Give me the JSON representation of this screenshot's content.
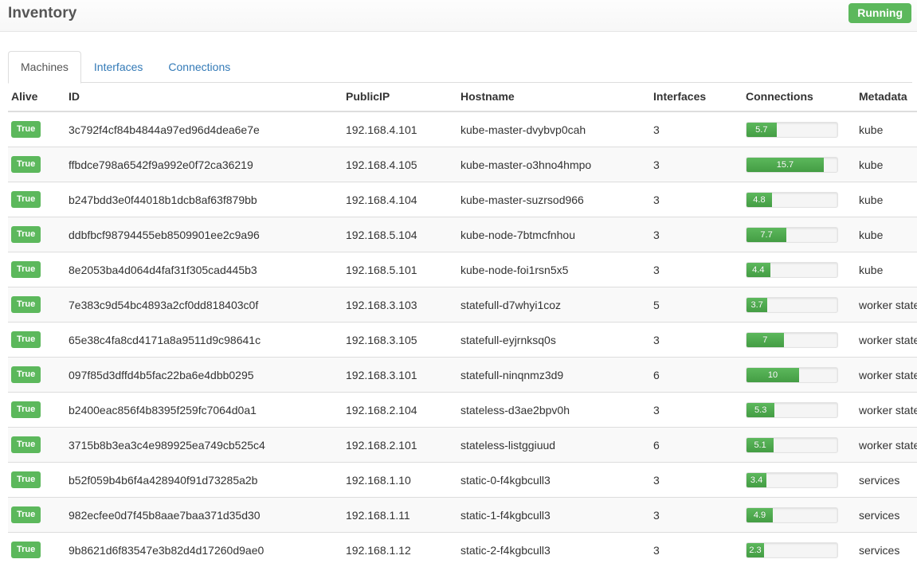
{
  "header": {
    "title": "Inventory",
    "status_label": "Running",
    "status_color": "#5cb85c"
  },
  "tabs": [
    {
      "label": "Machines",
      "active": true
    },
    {
      "label": "Interfaces",
      "active": false
    },
    {
      "label": "Connections",
      "active": false
    }
  ],
  "table": {
    "columns": [
      "Alive",
      "ID",
      "PublicIP",
      "Hostname",
      "Interfaces",
      "Connections",
      "Metadata"
    ],
    "progress_max": 18.5,
    "rows": [
      {
        "alive": "True",
        "id": "3c792f4cf84b4844a97ed96d4dea6e7e",
        "public_ip": "192.168.4.101",
        "hostname": "kube-master-dvybvp0cah",
        "interfaces": "3",
        "connections": "5.7",
        "connections_pct": 33,
        "metadata": "kube"
      },
      {
        "alive": "True",
        "id": "ffbdce798a6542f9a992e0f72ca36219",
        "public_ip": "192.168.4.105",
        "hostname": "kube-master-o3hno4hmpo",
        "interfaces": "3",
        "connections": "15.7",
        "connections_pct": 85,
        "metadata": "kube"
      },
      {
        "alive": "True",
        "id": "b247bdd3e0f44018b1dcb8af63f879bb",
        "public_ip": "192.168.4.104",
        "hostname": "kube-master-suzrsod966",
        "interfaces": "3",
        "connections": "4.8",
        "connections_pct": 28,
        "metadata": "kube"
      },
      {
        "alive": "True",
        "id": "ddbfbcf98794455eb8509901ee2c9a96",
        "public_ip": "192.168.5.104",
        "hostname": "kube-node-7btmcfnhou",
        "interfaces": "3",
        "connections": "7.7",
        "connections_pct": 44,
        "metadata": "kube"
      },
      {
        "alive": "True",
        "id": "8e2053ba4d064d4faf31f305cad445b3",
        "public_ip": "192.168.5.101",
        "hostname": "kube-node-foi1rsn5x5",
        "interfaces": "3",
        "connections": "4.4",
        "connections_pct": 26,
        "metadata": "kube"
      },
      {
        "alive": "True",
        "id": "7e383c9d54bc4893a2cf0dd818403c0f",
        "public_ip": "192.168.3.103",
        "hostname": "statefull-d7whyi1coz",
        "interfaces": "5",
        "connections": "3.7",
        "connections_pct": 23,
        "metadata": "worker statefull"
      },
      {
        "alive": "True",
        "id": "65e38c4fa8cd4171a8a9511d9c98641c",
        "public_ip": "192.168.3.105",
        "hostname": "statefull-eyjrnksq0s",
        "interfaces": "3",
        "connections": "7",
        "connections_pct": 41,
        "metadata": "worker statefull"
      },
      {
        "alive": "True",
        "id": "097f85d3dffd4b5fac22ba6e4dbb0295",
        "public_ip": "192.168.3.101",
        "hostname": "statefull-ninqnmz3d9",
        "interfaces": "6",
        "connections": "10",
        "connections_pct": 58,
        "metadata": "worker statefull"
      },
      {
        "alive": "True",
        "id": "b2400eac856f4b8395f259fc7064d0a1",
        "public_ip": "192.168.2.104",
        "hostname": "stateless-d3ae2bpv0h",
        "interfaces": "3",
        "connections": "5.3",
        "connections_pct": 31,
        "metadata": "worker stateless"
      },
      {
        "alive": "True",
        "id": "3715b8b3ea3c4e989925ea749cb525c4",
        "public_ip": "192.168.2.101",
        "hostname": "stateless-listggiuud",
        "interfaces": "6",
        "connections": "5.1",
        "connections_pct": 30,
        "metadata": "worker stateless"
      },
      {
        "alive": "True",
        "id": "b52f059b4b6f4a428940f91d73285a2b",
        "public_ip": "192.168.1.10",
        "hostname": "static-0-f4kgbcull3",
        "interfaces": "3",
        "connections": "3.4",
        "connections_pct": 22,
        "metadata": "services"
      },
      {
        "alive": "True",
        "id": "982ecfee0d7f45b8aae7baa371d35d30",
        "public_ip": "192.168.1.11",
        "hostname": "static-1-f4kgbcull3",
        "interfaces": "3",
        "connections": "4.9",
        "connections_pct": 29,
        "metadata": "services"
      },
      {
        "alive": "True",
        "id": "9b8621d6f83547e3b82d4d17260d9ae0",
        "public_ip": "192.168.1.12",
        "hostname": "static-2-f4kgbcull3",
        "interfaces": "3",
        "connections": "2.3",
        "connections_pct": 19,
        "metadata": "services"
      }
    ]
  }
}
